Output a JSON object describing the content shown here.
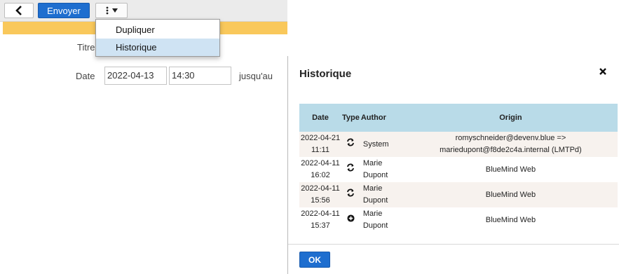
{
  "toolbar": {
    "back_icon": "chevron-left-icon",
    "send_label": "Envoyer",
    "more_icon": "kebab-menu-icon",
    "caret_icon": "caret-down-icon"
  },
  "form": {
    "title_label": "Titre",
    "date_label": "Date",
    "date_value": "2022-04-13",
    "time_value": "14:30",
    "until_label": "jusqu'au"
  },
  "menu": {
    "items": [
      {
        "label": "Dupliquer"
      },
      {
        "label": "Historique"
      }
    ]
  },
  "dialog": {
    "title": "Historique",
    "close_icon": "close-icon",
    "columns": {
      "date": "Date",
      "type": "Type",
      "author": "Author",
      "origin": "Origin"
    },
    "rows": [
      {
        "date": "2022-04-21",
        "time": "11:11",
        "type_icon": "sync-icon",
        "author": "System",
        "origin_line1": "romyschneider@devenv.blue =>",
        "origin_line2": "mariedupont@f8de2c4a.internal (LMTPd)"
      },
      {
        "date": "2022-04-11",
        "time": "16:02",
        "type_icon": "sync-icon",
        "author": "Marie Dupont",
        "origin_line1": "BlueMind Web",
        "origin_line2": ""
      },
      {
        "date": "2022-04-11",
        "time": "15:56",
        "type_icon": "sync-icon",
        "author": "Marie Dupont",
        "origin_line1": "BlueMind Web",
        "origin_line2": ""
      },
      {
        "date": "2022-04-11",
        "time": "15:37",
        "type_icon": "add-icon",
        "author": "Marie Dupont",
        "origin_line1": "BlueMind Web",
        "origin_line2": ""
      }
    ],
    "ok_label": "OK"
  },
  "colors": {
    "accent_blue": "#1e6ecf",
    "header_blue": "#b9dbe8",
    "warning_yellow": "#f9c85b",
    "menu_highlight": "#cfe3f3"
  }
}
